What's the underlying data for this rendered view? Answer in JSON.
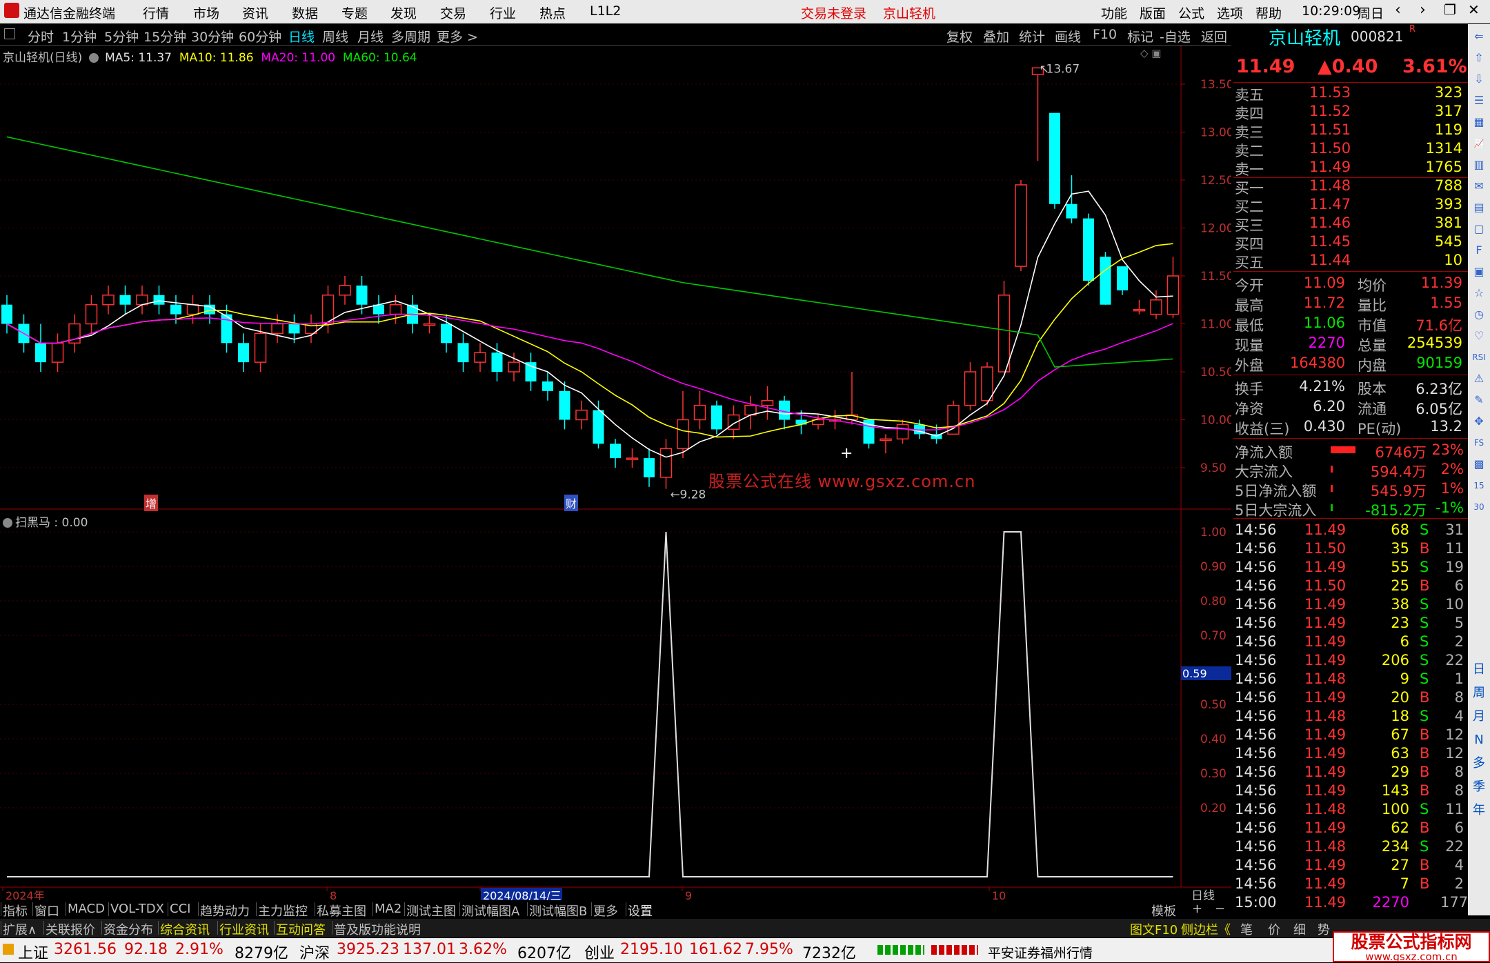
{
  "app": {
    "title": "通达信金融终端",
    "menus": [
      "行情",
      "市场",
      "资讯",
      "数据",
      "专题",
      "发现",
      "交易",
      "行业",
      "热点",
      "L1L2"
    ],
    "login": "交易未登录",
    "stock_title": "京山轻机",
    "right_menus": [
      "功能",
      "版面",
      "公式",
      "选项",
      "帮助"
    ],
    "time": "10:29:09",
    "weekday": "周日"
  },
  "periods": [
    "分时",
    "1分钟",
    "5分钟",
    "15分钟",
    "30分钟",
    "60分钟",
    "日线",
    "周线",
    "月线",
    "多周期",
    "更多 >"
  ],
  "active_period": "日线",
  "tools": [
    "复权",
    "叠加",
    "统计",
    "画线",
    "F10",
    "标记",
    "-自选",
    "返回"
  ],
  "chart": {
    "header_name": "京山轻机(日线)",
    "ma5": "MA5: 11.37",
    "ma10": "MA10: 11.86",
    "ma20": "MA20: 11.00",
    "ma60": "MA60: 10.64",
    "high_label": "13.67",
    "low_label": "9.28",
    "watermark": "股票公式在线  www.gsxz.com.cn",
    "tag_zeng": "增",
    "tag_cai": "财",
    "price_ticks": [
      "13.50",
      "13.00",
      "12.50",
      "12.00",
      "11.50",
      "11.00",
      "10.50",
      "10.00",
      "9.50"
    ],
    "indicator_name": "扫黑马 : 0.00",
    "ind_ticks": [
      "1.00",
      "0.90",
      "0.80",
      "0.70",
      "0.59",
      "0.50",
      "0.40",
      "0.30",
      "0.20"
    ],
    "current_ind": "0.59",
    "x_labels": [
      "2024年",
      "8",
      "2024/08/14/三",
      "9",
      "10"
    ],
    "period_label": "日线"
  },
  "candles": [
    [
      11.2,
      11.0,
      11.3,
      10.9
    ],
    [
      11.0,
      10.8,
      11.1,
      10.7
    ],
    [
      10.8,
      10.6,
      11.0,
      10.5
    ],
    [
      10.6,
      10.8,
      10.9,
      10.5
    ],
    [
      10.8,
      11.0,
      11.1,
      10.7
    ],
    [
      11.0,
      11.2,
      11.3,
      10.9
    ],
    [
      11.2,
      11.3,
      11.4,
      11.1
    ],
    [
      11.3,
      11.2,
      11.4,
      11.1
    ],
    [
      11.2,
      11.3,
      11.4,
      11.1
    ],
    [
      11.3,
      11.2,
      11.4,
      11.1
    ],
    [
      11.2,
      11.1,
      11.3,
      11.0
    ],
    [
      11.1,
      11.2,
      11.3,
      11.0
    ],
    [
      11.2,
      11.1,
      11.3,
      11.0
    ],
    [
      11.1,
      10.8,
      11.2,
      10.7
    ],
    [
      10.8,
      10.6,
      10.9,
      10.5
    ],
    [
      10.6,
      10.9,
      11.0,
      10.5
    ],
    [
      10.9,
      11.0,
      11.1,
      10.8
    ],
    [
      11.0,
      10.9,
      11.1,
      10.8
    ],
    [
      10.9,
      11.0,
      11.1,
      10.8
    ],
    [
      11.0,
      11.3,
      11.4,
      10.9
    ],
    [
      11.3,
      11.4,
      11.5,
      11.2
    ],
    [
      11.4,
      11.2,
      11.5,
      11.1
    ],
    [
      11.2,
      11.1,
      11.3,
      11.0
    ],
    [
      11.1,
      11.2,
      11.3,
      11.0
    ],
    [
      11.2,
      11.0,
      11.3,
      10.9
    ],
    [
      11.0,
      11.0,
      11.1,
      10.9
    ],
    [
      11.0,
      10.8,
      11.1,
      10.7
    ],
    [
      10.8,
      10.6,
      10.9,
      10.5
    ],
    [
      10.6,
      10.7,
      10.8,
      10.5
    ],
    [
      10.7,
      10.5,
      10.8,
      10.4
    ],
    [
      10.5,
      10.6,
      10.7,
      10.4
    ],
    [
      10.6,
      10.4,
      10.7,
      10.3
    ],
    [
      10.4,
      10.3,
      10.5,
      10.2
    ],
    [
      10.3,
      10.0,
      10.4,
      9.9
    ],
    [
      10.0,
      10.1,
      10.2,
      9.9
    ],
    [
      10.1,
      9.75,
      10.2,
      9.7
    ],
    [
      9.75,
      9.6,
      9.8,
      9.5
    ],
    [
      9.6,
      9.6,
      9.7,
      9.5
    ],
    [
      9.6,
      9.4,
      9.7,
      9.3
    ],
    [
      9.4,
      9.7,
      9.8,
      9.28
    ],
    [
      9.7,
      10.0,
      10.3,
      9.6
    ],
    [
      10.0,
      10.15,
      10.3,
      9.9
    ],
    [
      10.15,
      9.9,
      10.2,
      9.85
    ],
    [
      9.9,
      10.05,
      10.15,
      9.8
    ],
    [
      10.05,
      10.15,
      10.25,
      9.9
    ],
    [
      10.15,
      10.2,
      10.35,
      10.0
    ],
    [
      10.2,
      10.0,
      10.25,
      9.9
    ],
    [
      10.0,
      9.95,
      10.1,
      9.85
    ],
    [
      9.95,
      10.0,
      10.05,
      9.9
    ],
    [
      10.0,
      10.0,
      10.1,
      9.9
    ],
    [
      10.0,
      10.05,
      10.5,
      9.95
    ],
    [
      10.0,
      9.75,
      10.0,
      9.7
    ],
    [
      9.8,
      9.8,
      9.85,
      9.65
    ],
    [
      9.8,
      9.95,
      10.0,
      9.75
    ],
    [
      9.95,
      9.85,
      10.0,
      9.8
    ],
    [
      9.85,
      9.8,
      9.95,
      9.75
    ],
    [
      9.85,
      10.15,
      10.2,
      9.85
    ],
    [
      10.15,
      10.5,
      10.6,
      10.1
    ],
    [
      10.2,
      10.55,
      10.6,
      10.15
    ],
    [
      10.5,
      11.3,
      11.45,
      10.5
    ],
    [
      11.6,
      12.45,
      12.5,
      11.55
    ],
    [
      13.6,
      13.67,
      13.67,
      12.7
    ],
    [
      13.2,
      12.25,
      13.2,
      12.2
    ],
    [
      12.25,
      12.1,
      12.55,
      12.05
    ],
    [
      12.1,
      11.45,
      12.15,
      11.4
    ],
    [
      11.7,
      11.2,
      11.75,
      11.2
    ],
    [
      11.6,
      11.35,
      11.6,
      11.3
    ],
    [
      11.15,
      11.15,
      11.25,
      11.1
    ],
    [
      11.1,
      11.25,
      11.35,
      11.05
    ],
    [
      11.1,
      11.5,
      11.7,
      11.06
    ]
  ],
  "ind_peaks": [
    {
      "from": 38,
      "peak": 39,
      "to": 40
    },
    {
      "from": 58,
      "peak": 59,
      "peak2": 60,
      "to": 61
    }
  ],
  "side": {
    "name": "京山轻机",
    "code": "000821",
    "flag": "R",
    "price": "11.49",
    "change": "▲0.40",
    "pct": "3.61%",
    "sell": [
      [
        "卖五",
        "11.53",
        "323"
      ],
      [
        "卖四",
        "11.52",
        "317"
      ],
      [
        "卖三",
        "11.51",
        "119"
      ],
      [
        "卖二",
        "11.50",
        "1314"
      ],
      [
        "卖一",
        "11.49",
        "1765"
      ]
    ],
    "buy": [
      [
        "买一",
        "11.48",
        "788"
      ],
      [
        "买二",
        "11.47",
        "393"
      ],
      [
        "买三",
        "11.46",
        "381"
      ],
      [
        "买四",
        "11.45",
        "545"
      ],
      [
        "买五",
        "11.44",
        "10"
      ]
    ],
    "stats": [
      [
        "今开",
        "11.09",
        "均价",
        "11.39"
      ],
      [
        "最高",
        "11.72",
        "量比",
        "1.55"
      ],
      [
        "最低",
        "11.06",
        "市值",
        "71.6亿"
      ],
      [
        "现量",
        "2270",
        "总量",
        "254539"
      ],
      [
        "外盘",
        "164380",
        "内盘",
        "90159"
      ]
    ],
    "stats2": [
      [
        "换手",
        "4.21%",
        "股本",
        "6.23亿"
      ],
      [
        "净资",
        "6.20",
        "流通",
        "6.05亿"
      ],
      [
        "收益(三)",
        "0.430",
        "PE(动)",
        "13.2"
      ]
    ],
    "flows": [
      [
        "净流入额",
        "6746万",
        "23%"
      ],
      [
        "大宗流入",
        "594.4万",
        "2%"
      ],
      [
        "5日净流入额",
        "545.9万",
        "1%"
      ],
      [
        "5日大宗流入",
        "-815.2万",
        "-1%"
      ]
    ],
    "ticks": [
      [
        "14:56",
        "11.49",
        "68",
        "S",
        "31"
      ],
      [
        "14:56",
        "11.50",
        "35",
        "B",
        "11"
      ],
      [
        "14:56",
        "11.49",
        "55",
        "S",
        "19"
      ],
      [
        "14:56",
        "11.50",
        "25",
        "B",
        "6"
      ],
      [
        "14:56",
        "11.49",
        "38",
        "S",
        "10"
      ],
      [
        "14:56",
        "11.49",
        "23",
        "S",
        "5"
      ],
      [
        "14:56",
        "11.49",
        "6",
        "S",
        "2"
      ],
      [
        "14:56",
        "11.49",
        "206",
        "S",
        "22"
      ],
      [
        "14:56",
        "11.48",
        "9",
        "S",
        "1"
      ],
      [
        "14:56",
        "11.49",
        "20",
        "B",
        "8"
      ],
      [
        "14:56",
        "11.48",
        "18",
        "S",
        "4"
      ],
      [
        "14:56",
        "11.49",
        "67",
        "B",
        "12"
      ],
      [
        "14:56",
        "11.49",
        "63",
        "B",
        "12"
      ],
      [
        "14:56",
        "11.49",
        "29",
        "B",
        "8"
      ],
      [
        "14:56",
        "11.49",
        "143",
        "B",
        "8"
      ],
      [
        "14:56",
        "11.48",
        "100",
        "S",
        "11"
      ],
      [
        "14:56",
        "11.49",
        "62",
        "B",
        "6"
      ],
      [
        "14:56",
        "11.48",
        "234",
        "S",
        "22"
      ],
      [
        "14:56",
        "11.49",
        "27",
        "B",
        "4"
      ],
      [
        "14:56",
        "11.49",
        "7",
        "B",
        "2"
      ],
      [
        "15:00",
        "11.49",
        "2270",
        "",
        177
      ]
    ]
  },
  "bottom_tabs": [
    "指标",
    "窗口",
    "MACD",
    "VOL-TDX",
    "CCI",
    "趋势动力",
    "主力监控",
    "私募主图",
    "MA2",
    "测试主图",
    "测试幅图A",
    "测试幅图B",
    "更多",
    "设置"
  ],
  "bottom_right": [
    "模板",
    "+",
    "−"
  ],
  "bottom_tabs2": [
    "扩展∧",
    "关联报价",
    "资金分布",
    "综合资讯",
    "行业资讯",
    "互动问答",
    "普及版功能说明"
  ],
  "bottom_tabs2_right": [
    "图文F10",
    "侧边栏《",
    "笔",
    "价",
    "细",
    "势"
  ],
  "side_icons": [
    "日",
    "周",
    "月",
    "N",
    "多",
    "季",
    "年"
  ],
  "status": {
    "sh_name": "上证",
    "sh_val": "3261.56",
    "sh_chg": "92.18",
    "sh_pct": "2.91%",
    "sh_amt": "8279亿",
    "sz_name": "沪深",
    "sz_val": "3925.23",
    "sz_chg": "137.01",
    "sz_pct": "3.62%",
    "sz_amt": "6207亿",
    "cy_name": "创业",
    "cy_val": "2195.10",
    "cy_chg": "161.62",
    "cy_pct": "7.95%",
    "cy_amt": "7232亿",
    "broker": "平安证券福州行情",
    "brand": "股票公式指标网",
    "brand_url": "www.gsxz.com.cn"
  },
  "colors": {
    "up": "#ff3232",
    "down": "#00ffff",
    "ma5": "#ffffff",
    "ma10": "#ffff00",
    "ma20": "#ff00ff",
    "ma60": "#00c800"
  }
}
